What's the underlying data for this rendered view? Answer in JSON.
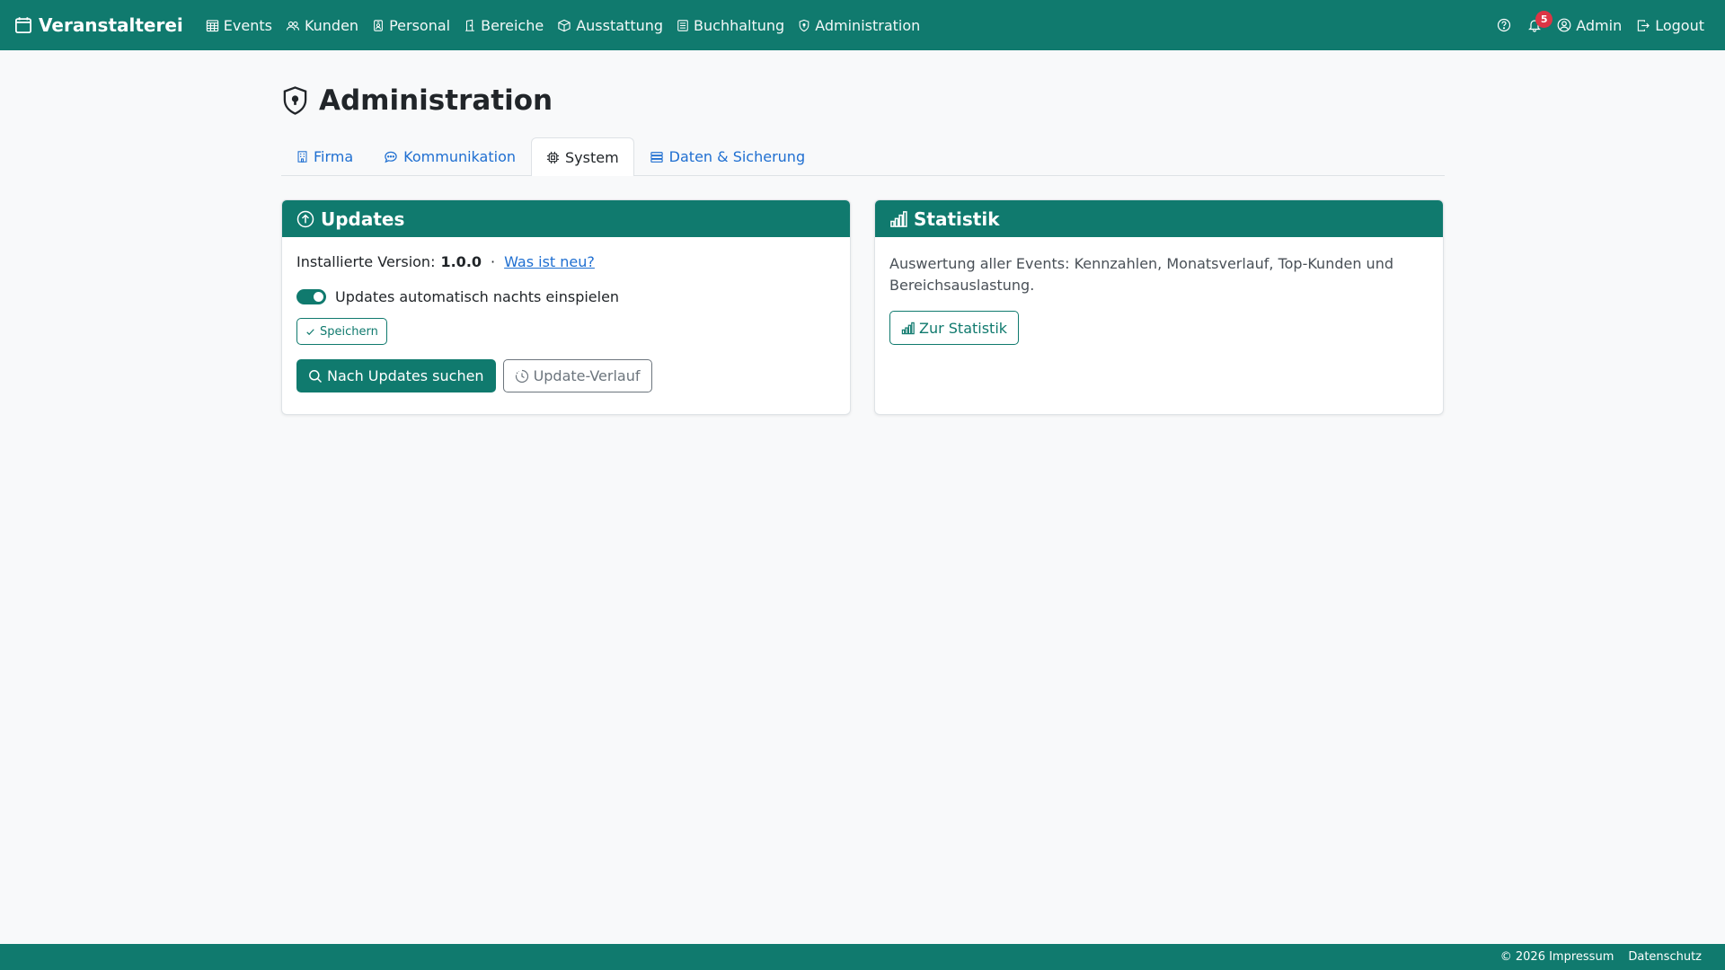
{
  "colors": {
    "primary": "#107a6e",
    "link": "#1f6fd1",
    "badge": "#dc3545"
  },
  "navbar": {
    "brand": "Veranstalterei",
    "items": [
      {
        "label": "Events",
        "icon": "calendar-grid-icon"
      },
      {
        "label": "Kunden",
        "icon": "people-icon"
      },
      {
        "label": "Personal",
        "icon": "person-badge-icon"
      },
      {
        "label": "Bereiche",
        "icon": "door-icon"
      },
      {
        "label": "Ausstattung",
        "icon": "box-icon"
      },
      {
        "label": "Buchhaltung",
        "icon": "journal-icon"
      },
      {
        "label": "Administration",
        "icon": "shield-icon"
      }
    ],
    "notification_count": "5",
    "user_label": "Admin",
    "logout_label": "Logout"
  },
  "page": {
    "title": "Administration",
    "tabs": [
      {
        "label": "Firma",
        "icon": "building-icon",
        "active": false
      },
      {
        "label": "Kommunikation",
        "icon": "chat-icon",
        "active": false
      },
      {
        "label": "System",
        "icon": "cpu-icon",
        "active": true
      },
      {
        "label": "Daten & Sicherung",
        "icon": "database-icon",
        "active": false
      }
    ]
  },
  "updates_card": {
    "title": "Updates",
    "version_label": "Installierte Version:",
    "version_value": "1.0.0",
    "separator": "·",
    "whats_new_link": "Was ist neu?",
    "auto_update_label": "Updates automatisch nachts einspielen",
    "auto_update_enabled": true,
    "save_button": "Speichern",
    "check_button": "Nach Updates suchen",
    "history_button": "Update-Verlauf"
  },
  "stats_card": {
    "title": "Statistik",
    "description": "Auswertung aller Events: Kennzahlen, Monatsverlauf, Top-Kunden und Bereichsauslastung.",
    "button": "Zur Statistik"
  },
  "footer": {
    "impressum": "© 2026 Impressum",
    "datenschutz": "Datenschutz"
  }
}
